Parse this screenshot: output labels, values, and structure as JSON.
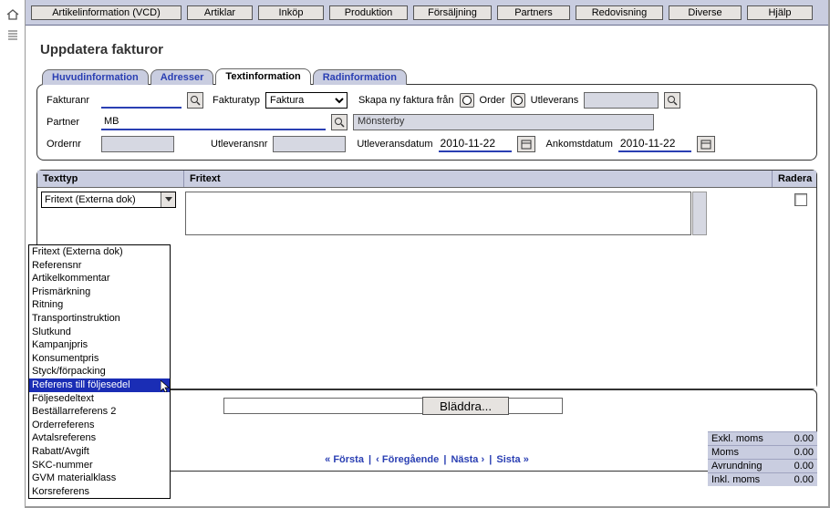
{
  "menu": [
    {
      "label": "Artikelinformation (VCD)",
      "w": 165
    },
    {
      "label": "Artiklar",
      "w": 72
    },
    {
      "label": "Inköp",
      "w": 72
    },
    {
      "label": "Produktion",
      "w": 86
    },
    {
      "label": "Försäljning",
      "w": 86
    },
    {
      "label": "Partners",
      "w": 80
    },
    {
      "label": "Redovisning",
      "w": 96
    },
    {
      "label": "Diverse",
      "w": 80
    },
    {
      "label": "Hjälp",
      "w": 72
    }
  ],
  "page_title": "Uppdatera fakturor",
  "tabs": [
    {
      "label": "Huvudinformation",
      "active": false
    },
    {
      "label": "Adresser",
      "active": false
    },
    {
      "label": "Textinformation",
      "active": true
    },
    {
      "label": "Radinformation",
      "active": false
    }
  ],
  "form": {
    "fakturanr_label": "Fakturanr",
    "fakturanr_value": "",
    "fakturatyp_label": "Fakturatyp",
    "fakturatyp_value": "Faktura",
    "skapa_label": "Skapa ny faktura från",
    "order_label": "Order",
    "utleverans_label": "Utleverans",
    "utlev_value": "",
    "partner_label": "Partner",
    "partner_code": "MB",
    "partner_name": "Mönsterby",
    "ordernr_label": "Ordernr",
    "ordernr_value": "",
    "utleveransnr_label": "Utleveransnr",
    "utleveransnr_value": "",
    "utlevdatum_label": "Utleveransdatum",
    "utlevdatum_value": "2010-11-22",
    "ankdatum_label": "Ankomstdatum",
    "ankdatum_value": "2010-11-22"
  },
  "grid": {
    "col1": "Texttyp",
    "col2": "Fritext",
    "col3": "Radera",
    "selected_texttyp": "Fritext (Externa dok)",
    "options": [
      "Fritext (Externa dok)",
      "Referensnr",
      "Artikelkommentar",
      "Prismärkning",
      "Ritning",
      "Transportinstruktion",
      "Slutkund",
      "Kampanjpris",
      "Konsumentpris",
      "Styck/förpacking",
      "Referens till följesedel",
      "Följesedeltext",
      "Beställarreferens 2",
      "Orderreferens",
      "Avtalsreferens",
      "Rabatt/Avgift",
      "SKC-nummer",
      "GVM materialklass",
      "Korsreferens"
    ],
    "highlighted_index": 10
  },
  "browse_label": "Bläddra...",
  "totals": [
    {
      "label": "Exkl. moms",
      "value": "0.00"
    },
    {
      "label": "Moms",
      "value": "0.00"
    },
    {
      "label": "Avrundning",
      "value": "0.00"
    },
    {
      "label": "Inkl. moms",
      "value": "0.00"
    }
  ],
  "pager": {
    "first": "Första",
    "prev": "Föregående",
    "next": "Nästa",
    "last": "Sista"
  }
}
